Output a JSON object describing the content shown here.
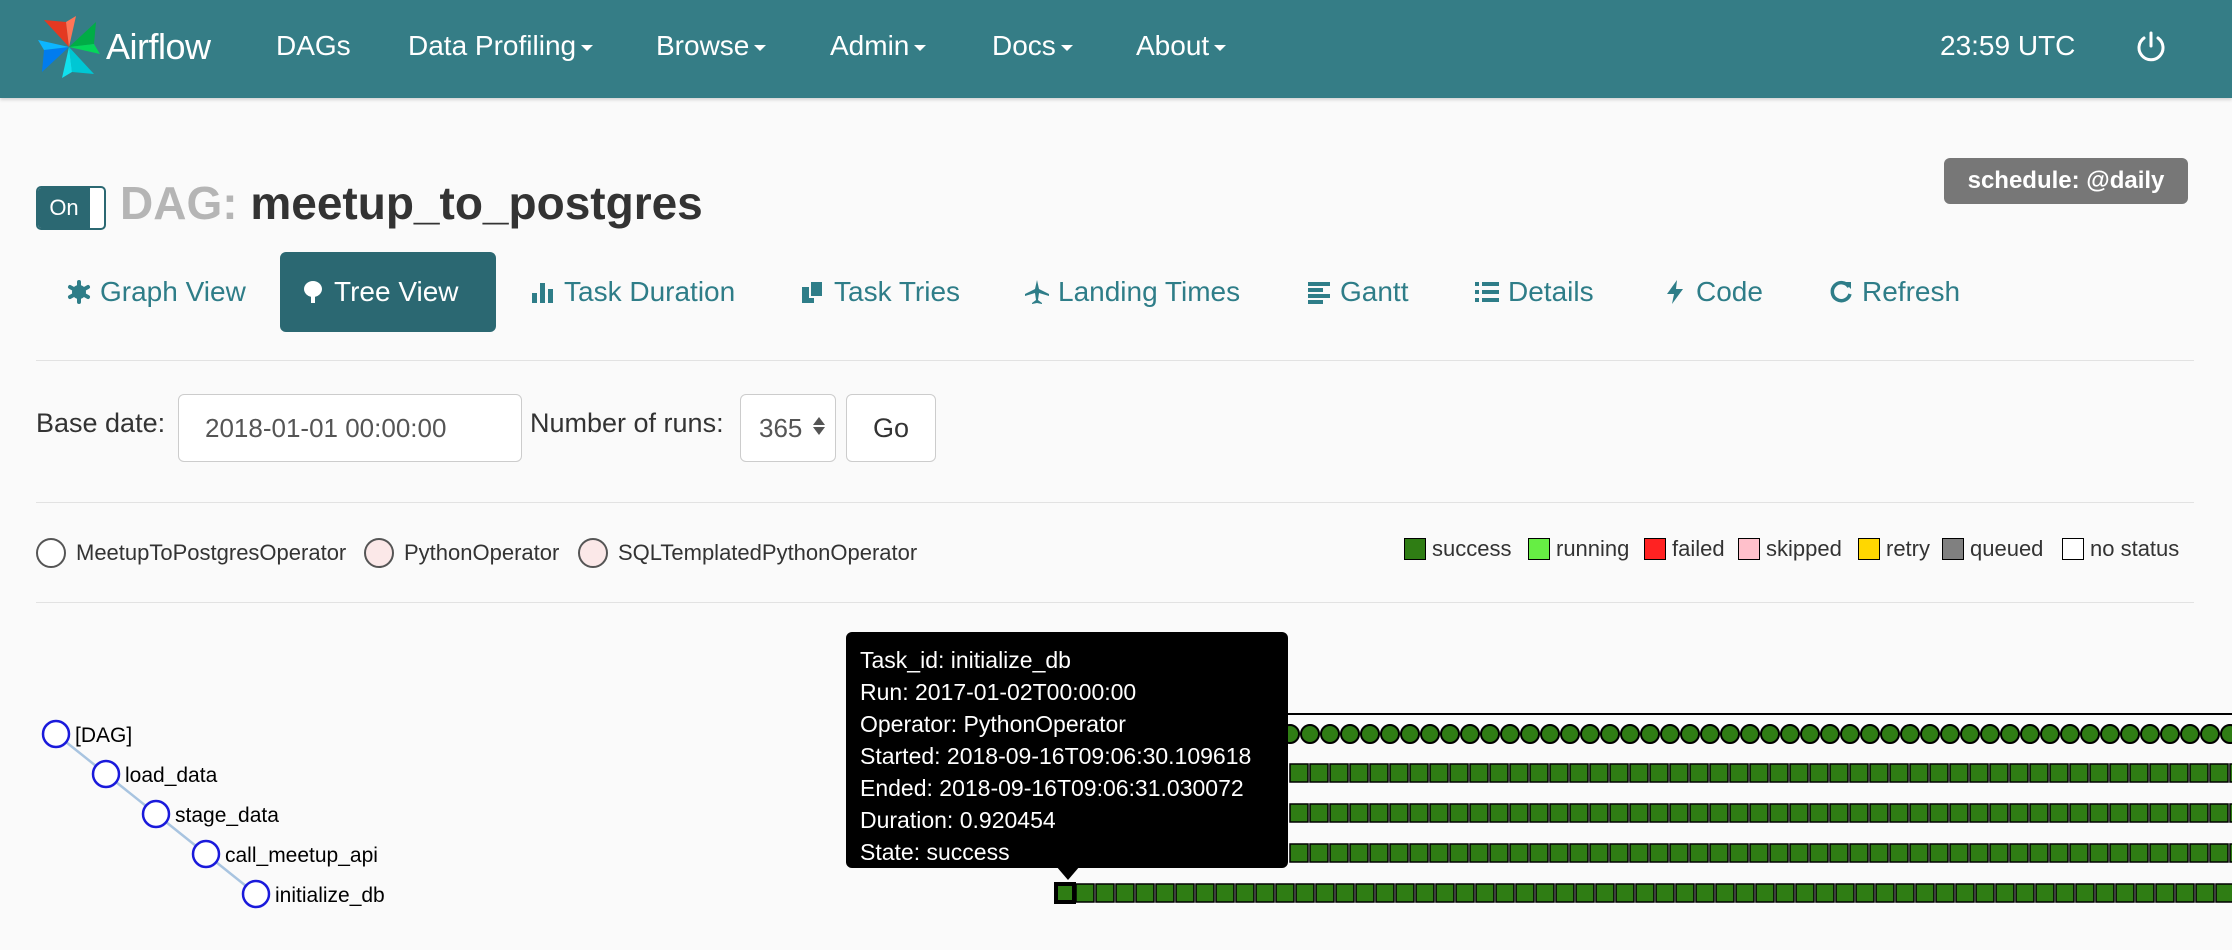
{
  "navbar": {
    "brand": "Airflow",
    "items": [
      {
        "label": "DAGs",
        "dropdown": false
      },
      {
        "label": "Data Profiling",
        "dropdown": true
      },
      {
        "label": "Browse",
        "dropdown": true
      },
      {
        "label": "Admin",
        "dropdown": true
      },
      {
        "label": "Docs",
        "dropdown": true
      },
      {
        "label": "About",
        "dropdown": true
      }
    ],
    "clock": "23:59 UTC"
  },
  "header": {
    "toggle_label": "On",
    "dag_label": "DAG:",
    "dag_name": "meetup_to_postgres",
    "schedule": "schedule: @daily"
  },
  "tabs": [
    {
      "label": "Graph View",
      "icon": "asterisk-icon",
      "active": false
    },
    {
      "label": "Tree View",
      "icon": "tree-icon",
      "active": true
    },
    {
      "label": "Task Duration",
      "icon": "bar-chart-icon",
      "active": false
    },
    {
      "label": "Task Tries",
      "icon": "duplicate-icon",
      "active": false
    },
    {
      "label": "Landing Times",
      "icon": "plane-icon",
      "active": false
    },
    {
      "label": "Gantt",
      "icon": "align-left-icon",
      "active": false
    },
    {
      "label": "Details",
      "icon": "list-icon",
      "active": false
    },
    {
      "label": "Code",
      "icon": "flash-icon",
      "active": false
    },
    {
      "label": "Refresh",
      "icon": "refresh-icon",
      "active": false
    }
  ],
  "form": {
    "base_date_label": "Base date:",
    "base_date_value": "2018-01-01 00:00:00",
    "num_runs_label": "Number of runs:",
    "num_runs_value": "365",
    "go_label": "Go"
  },
  "operators": [
    {
      "name": "MeetupToPostgresOperator",
      "color": "#ffffff"
    },
    {
      "name": "PythonOperator",
      "color": "#fbe8e8"
    },
    {
      "name": "SQLTemplatedPythonOperator",
      "color": "#fbe8e8"
    }
  ],
  "statuses": [
    {
      "name": "success",
      "color": "#2f7d14"
    },
    {
      "name": "running",
      "color": "#66ee44"
    },
    {
      "name": "failed",
      "color": "#ff2222"
    },
    {
      "name": "skipped",
      "color": "#ffc0cb"
    },
    {
      "name": "retry",
      "color": "#ffd700"
    },
    {
      "name": "queued",
      "color": "#808080"
    },
    {
      "name": "no status",
      "color": "#ffffff"
    }
  ],
  "tree": {
    "nodes": [
      "[DAG]",
      "load_data",
      "stage_data",
      "call_meetup_api",
      "initialize_db"
    ]
  },
  "tooltip": {
    "lines": [
      "Task_id: initialize_db",
      "Run: 2017-01-02T00:00:00",
      "Operator: PythonOperator",
      "Started: 2018-09-16T09:06:30.109618",
      "Ended: 2018-09-16T09:06:31.030072",
      "Duration: 0.920454",
      "State: success"
    ]
  }
}
